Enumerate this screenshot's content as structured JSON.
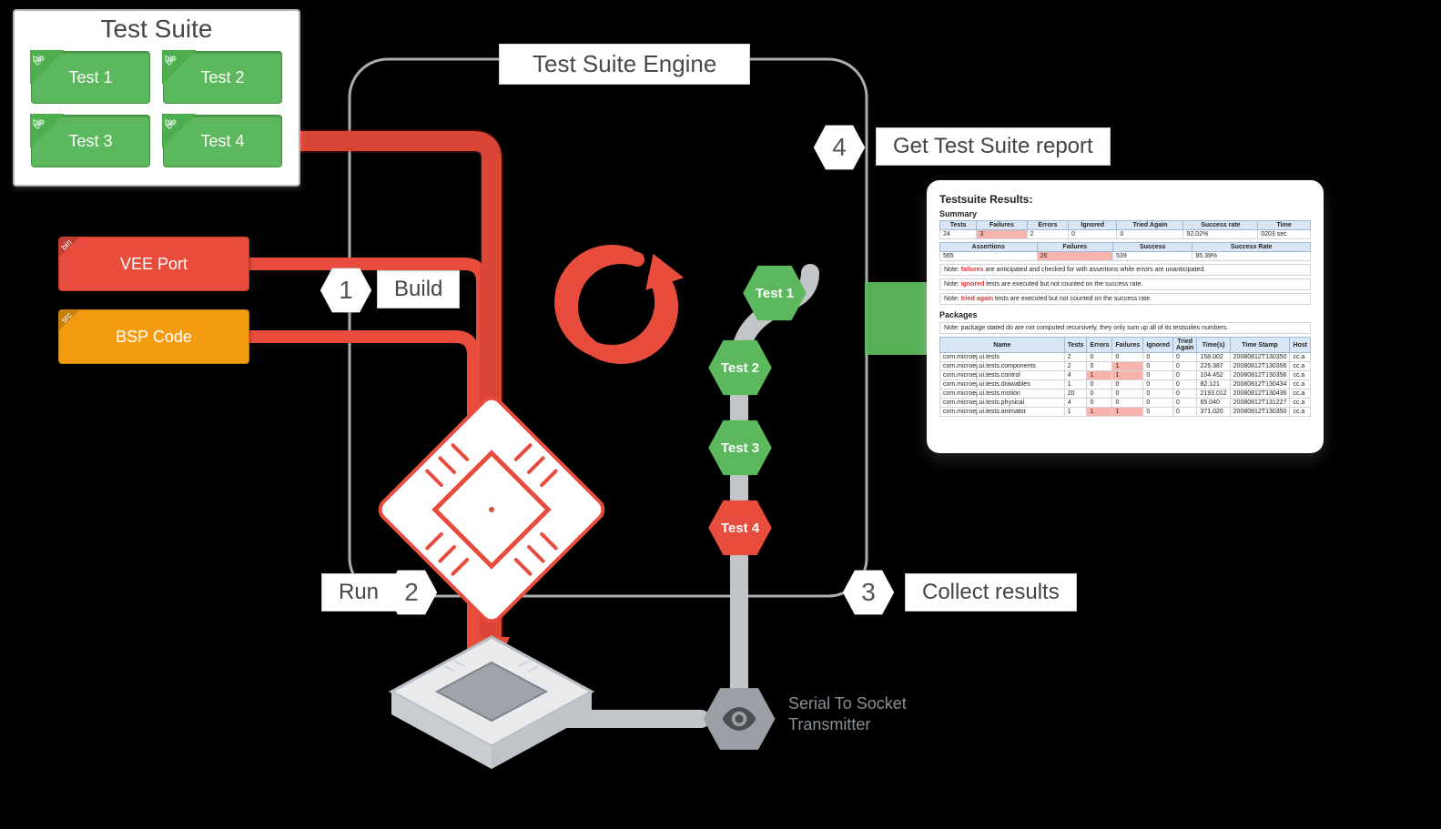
{
  "testSuite": {
    "title": "Test Suite",
    "items": [
      {
        "label": "Test 1",
        "corner": "bin"
      },
      {
        "label": "Test 2",
        "corner": "bin"
      },
      {
        "label": "Test 3",
        "corner": "bin"
      },
      {
        "label": "Test 4",
        "corner": "bin"
      }
    ]
  },
  "modules": {
    "vee": {
      "label": "VEE Port",
      "corner": "bin"
    },
    "bsp": {
      "label": "BSP Code",
      "corner": "src"
    }
  },
  "engine": {
    "title": "Test Suite Engine"
  },
  "steps": {
    "s1": {
      "num": "1",
      "label": "Build"
    },
    "s2": {
      "num": "2",
      "label": "Run"
    },
    "s3": {
      "num": "3",
      "label": "Collect results"
    },
    "s4": {
      "num": "4",
      "label": "Get Test Suite report"
    }
  },
  "resultNodes": [
    {
      "label": "Test 1",
      "status": "pass"
    },
    {
      "label": "Test 2",
      "status": "pass"
    },
    {
      "label": "Test 3",
      "status": "pass"
    },
    {
      "label": "Test 4",
      "status": "fail"
    }
  ],
  "serialSocket": {
    "label": "Serial To Socket\nTransmitter"
  },
  "report": {
    "title": "Testsuite Results:",
    "summaryLabel": "Summary",
    "summaryHeaders": [
      "Tests",
      "Failures",
      "Errors",
      "Ignored",
      "Tried Again",
      "Success rate",
      "Time"
    ],
    "summaryRow": [
      "24",
      "3",
      "2",
      "0",
      "0",
      "92.02%",
      "0203 sec"
    ],
    "assertHeaders": [
      "Assertions",
      "Failures",
      "Success",
      "Success Rate"
    ],
    "assertRow": [
      "565",
      "26",
      "539",
      "95.39%"
    ],
    "notes": [
      {
        "text_before": "Note: ",
        "highlight": "failures",
        "text_after": " are anticipated and checked for with assertions while errors are unanticipated."
      },
      {
        "text_before": "Note: ",
        "highlight": "ignored",
        "text_after": " tests are executed but not counted on the success rate."
      },
      {
        "text_before": "Note: ",
        "highlight": "tried again",
        "text_after": " tests are executed but not counted on the success rate."
      }
    ],
    "packagesLabel": "Packages",
    "packagesNote": "Note: package stated do are not computed recursively, they only sum up all of its testsuites numbers.",
    "pkgHeaders": [
      "Name",
      "Tests",
      "Errors",
      "Failures",
      "Ignored",
      "Tried Again",
      "Time(s)",
      "Time Stamp",
      "Host"
    ],
    "pkgRows": [
      [
        "com.microej.ui.tests",
        "2",
        "0",
        "0",
        "0",
        "0",
        "158.002",
        "20080812T130350",
        "cc.a"
      ],
      [
        "com.microej.ui.tests.components",
        "2",
        "0",
        "1",
        "0",
        "0",
        "226.387",
        "20080812T130356",
        "cc.a"
      ],
      [
        "com.microej.ui.tests.control",
        "4",
        "1",
        "1",
        "0",
        "0",
        "104.452",
        "20080812T130356",
        "cc.a"
      ],
      [
        "com.microej.ui.tests.drawables",
        "1",
        "0",
        "0",
        "0",
        "0",
        "82.121",
        "20080812T130434",
        "cc.a"
      ],
      [
        "com.microej.ui.tests.motion",
        "20",
        "0",
        "0",
        "0",
        "0",
        "2193.012",
        "20080812T130436",
        "cc.a"
      ],
      [
        "com.microej.ui.tests.physical",
        "4",
        "0",
        "0",
        "0",
        "0",
        "65.040",
        "20080812T131227",
        "cc.a"
      ],
      [
        "com.microej.ui.tests.animator",
        "1",
        "1",
        "1",
        "0",
        "0",
        "371.020",
        "20080812T130350",
        "cc.a"
      ]
    ]
  }
}
